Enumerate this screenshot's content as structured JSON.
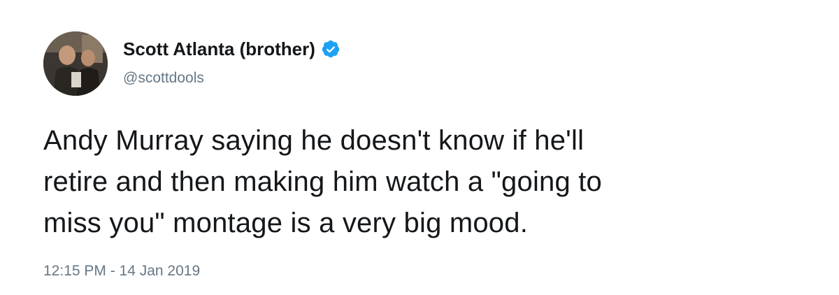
{
  "tweet": {
    "author": {
      "display_name": "Scott Atlanta (brother)",
      "handle": "@scottdools",
      "verified": true,
      "avatar_icon": "profile-photo",
      "verified_icon": "verified-badge-icon"
    },
    "text_lines": [
      "Andy Murray saying he doesn't know if he'll",
      "retire and then making him watch a \"going to",
      "miss you\" montage is a very big mood."
    ],
    "timestamp": "12:15 PM - 14 Jan 2019"
  },
  "colors": {
    "text_primary": "#14171a",
    "text_secondary": "#657786",
    "verified_blue": "#1da1f2",
    "background": "#ffffff"
  }
}
